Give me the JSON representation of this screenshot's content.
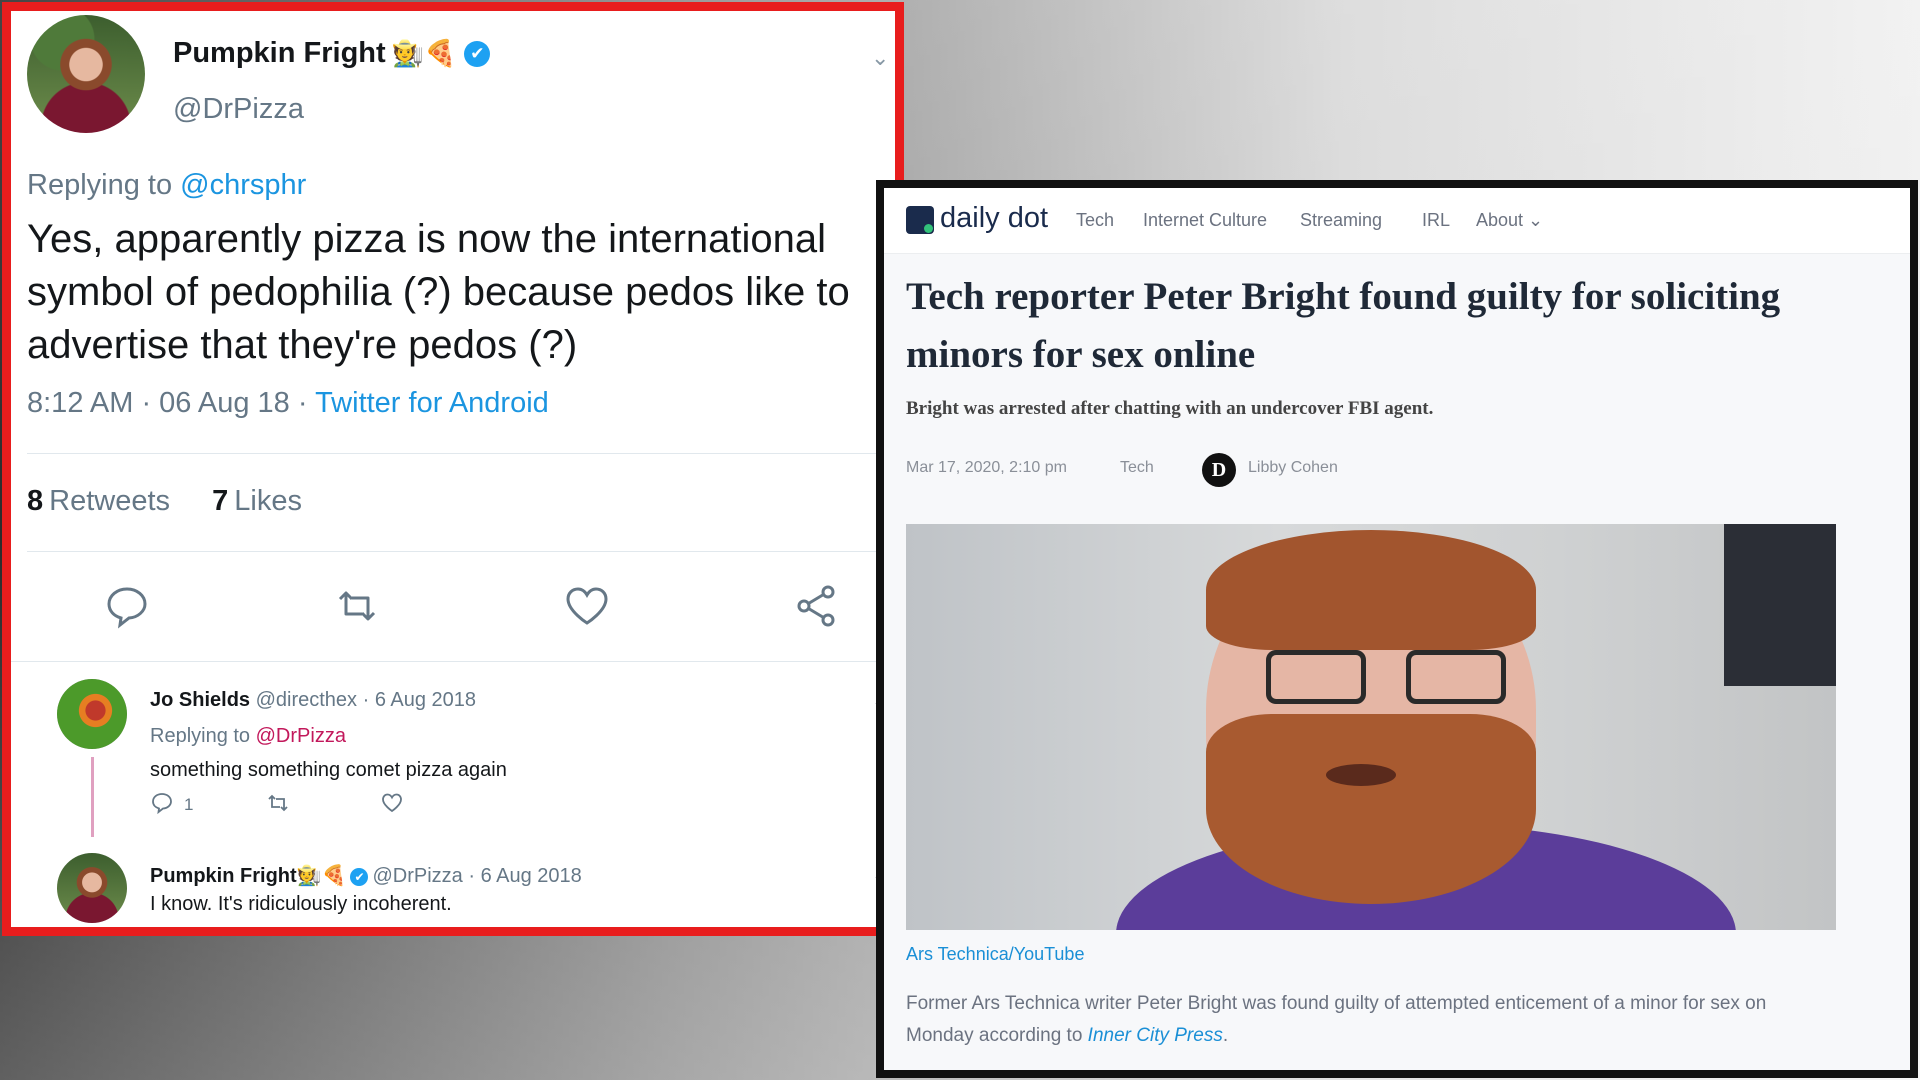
{
  "tweet": {
    "name": "Pumpkin Fright",
    "name_emoji": "🧑‍🌾🍕",
    "verified_glyph": "✔",
    "handle": "@DrPizza",
    "replying_prefix": "Replying to",
    "replying_to": "@chrsphr",
    "text": "Yes, apparently pizza is now the international symbol of pedophilia (?) because pedos like to advertise that they're pedos (?)",
    "timestamp": "8:12 AM · 06 Aug 18 ·",
    "client": "Twitter for Android",
    "retweets_count": "8",
    "retweets_label": "Retweets",
    "likes_count": "7",
    "likes_label": "Likes",
    "chevron": "⌄",
    "accent_color": "#1b95e0"
  },
  "replies": [
    {
      "name": "Jo Shields",
      "meta": "@directhex · 6 Aug 2018",
      "replying_prefix": "Replying to",
      "replying_to": "@DrPizza",
      "text": "something something comet pizza again",
      "reply_count": "1",
      "chevron": "⌄"
    },
    {
      "name": "Pumpkin Fright",
      "name_emoji": "🧑‍🌾🍕",
      "verified_glyph": "✔",
      "meta": "@DrPizza · 6 Aug 2018",
      "text": "I know. It's ridiculously incoherent.",
      "chevron": "⌄"
    }
  ],
  "article": {
    "logo_text": "daily dot",
    "nav": [
      "Tech",
      "Internet Culture",
      "Streaming",
      "IRL",
      "About ⌄"
    ],
    "title": "Tech reporter Peter Bright found guilty for soliciting minors for sex online",
    "subtitle": "Bright was arrested after chatting with an undercover FBI agent.",
    "date": "Mar 17, 2020, 2:10 pm",
    "category": "Tech",
    "author_initial": "D",
    "author": "Libby Cohen",
    "image_caption": "Ars Technica/YouTube",
    "body_text": "Former Ars Technica writer Peter Bright was found guilty of attempted enticement of a minor for sex on Monday according to",
    "body_link": "Inner City Press",
    "body_end": "."
  },
  "colors": {
    "tweet_frame": "#e81d1d",
    "article_frame": "#111111",
    "link_blue": "#1a8fd6",
    "reply_link": "#c2185b"
  }
}
